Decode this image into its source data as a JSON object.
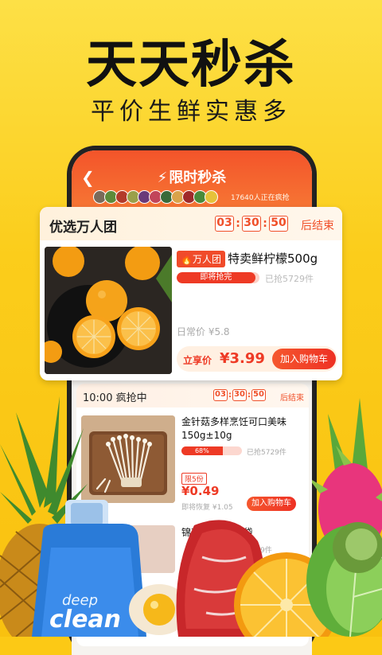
{
  "headline": "天天秒杀",
  "subheadline": "平价生鲜实惠多",
  "app": {
    "title": "限时秒杀",
    "back_icon": "chevron-left-icon",
    "title_icon": "lightning-icon",
    "shoppers_text": "17640人正在疯抢"
  },
  "featured": {
    "title": "优选万人团",
    "countdown": {
      "h": "03",
      "m": "30",
      "s": "50"
    },
    "countdown_suffix": "后结束",
    "product": {
      "badge": "万人团",
      "name": "特卖鲜柠檬500g",
      "progress_text": "即将抢完",
      "progress": 0.95,
      "sold": "已抢5729件",
      "regular_price": "日常价 ¥5.8",
      "price_label": "立享价",
      "price": "¥3.99",
      "add_cart": "加入购物车"
    }
  },
  "flash": {
    "title": "10:00  疯抢中",
    "countdown": {
      "h": "03",
      "m": "30",
      "s": "50"
    },
    "countdown_suffix": "后结束",
    "items": [
      {
        "name": "金针菇多样烹饪可口美味150g±10g",
        "progress_text": "68%",
        "progress": 0.68,
        "sold": "已抢5729件",
        "limit": "限5份",
        "price": "¥0.49",
        "regular_price": "即将恢复 ¥1.05",
        "add_cart": "加入购物车"
      },
      {
        "name": "锦育",
        "name_tail": "/袋",
        "sold": "5729件"
      }
    ]
  },
  "decorations": {
    "bottle_text_1": "deep",
    "bottle_text_2": "clean"
  },
  "colors": {
    "background": "#fcc915",
    "accent": "#ee3a25",
    "header": "#f3542a"
  }
}
